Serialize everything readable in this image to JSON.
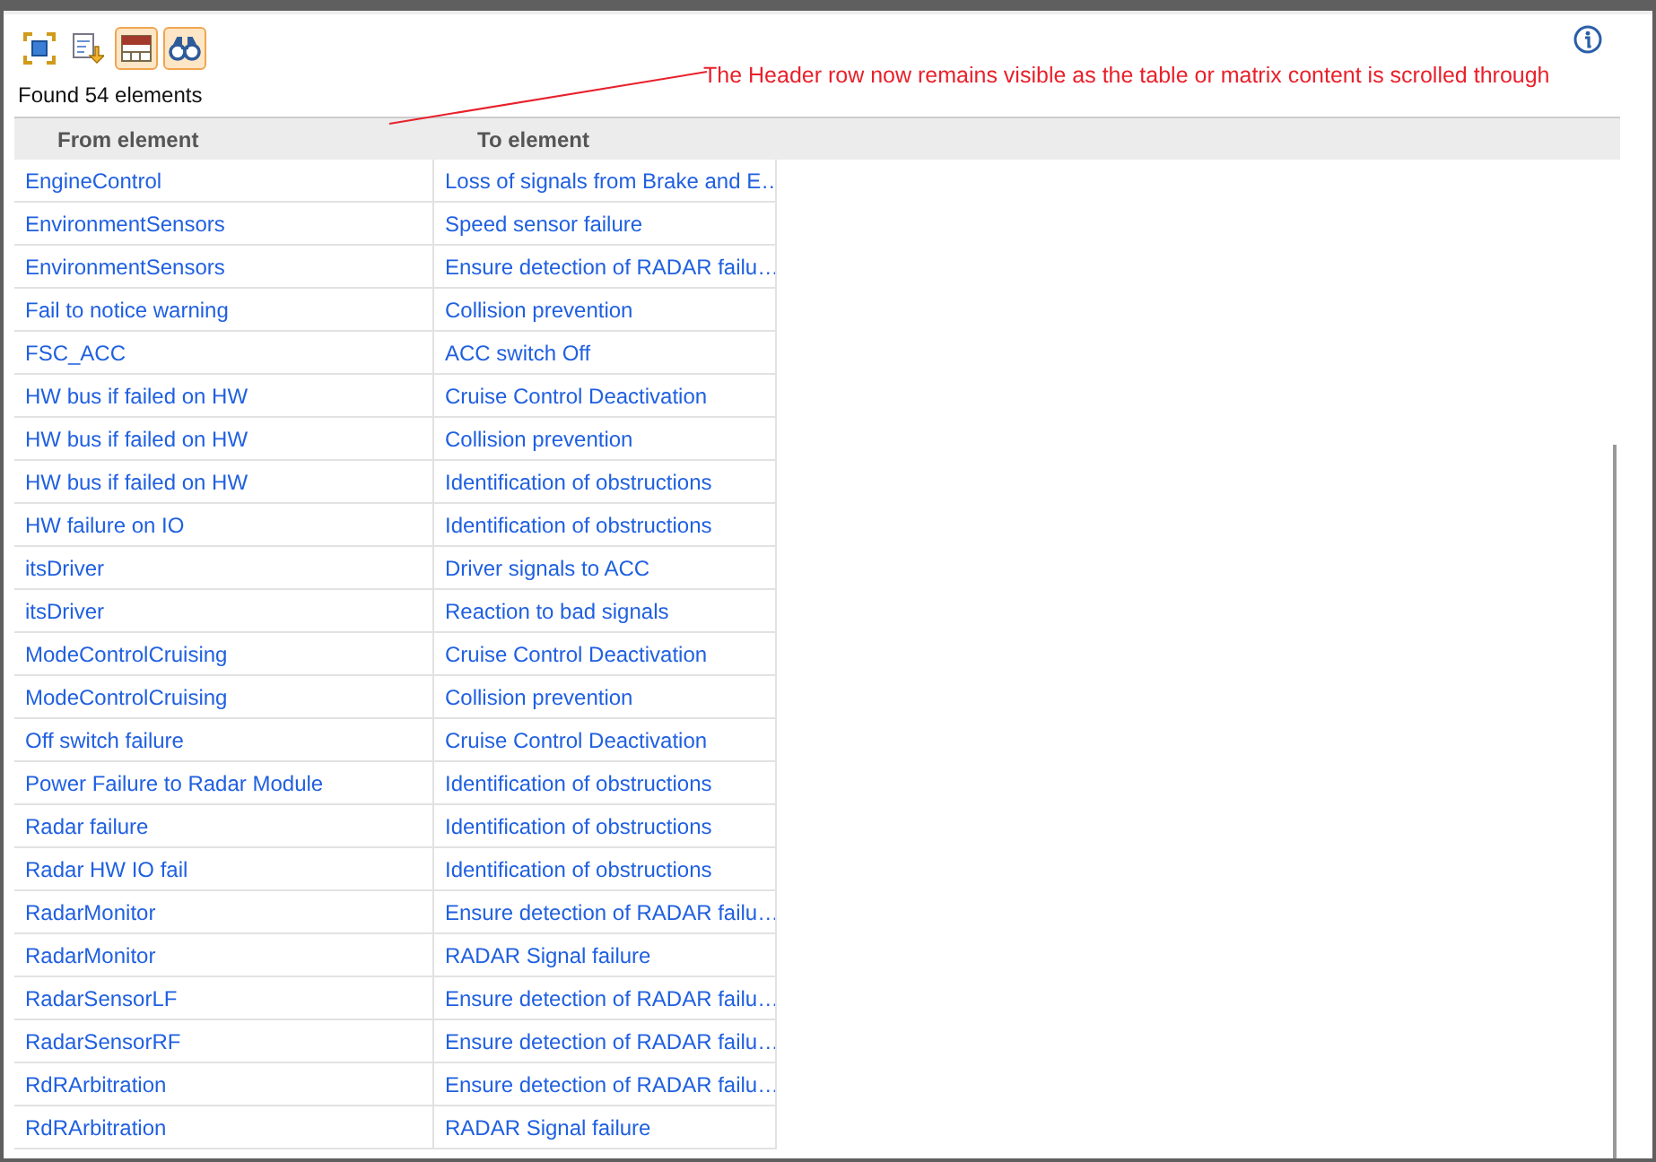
{
  "toolbar": [
    {
      "kind": "fit",
      "selected": false
    },
    {
      "kind": "export",
      "selected": false
    },
    {
      "kind": "header",
      "selected": true
    },
    {
      "kind": "find",
      "selected": true
    }
  ],
  "status": "Found 54 elements",
  "annotation": "The Header row now remains visible as the table or matrix content is scrolled through",
  "table": {
    "columns": [
      "From element",
      "To element"
    ],
    "rows": [
      [
        "EngineControl",
        "Loss of signals from Brake and E…"
      ],
      [
        "EnvironmentSensors",
        "Speed sensor failure"
      ],
      [
        "EnvironmentSensors",
        "Ensure detection of RADAR failu…"
      ],
      [
        "Fail to notice warning",
        "Collision prevention"
      ],
      [
        "FSC_ACC",
        "ACC switch Off"
      ],
      [
        "HW bus if failed on HW",
        "Cruise Control Deactivation"
      ],
      [
        "HW bus if failed on HW",
        "Collision prevention"
      ],
      [
        "HW bus if failed on HW",
        "Identification of obstructions"
      ],
      [
        "HW failure on IO",
        "Identification of obstructions"
      ],
      [
        "itsDriver",
        "Driver signals to ACC"
      ],
      [
        "itsDriver",
        "Reaction to bad signals"
      ],
      [
        "ModeControlCruising",
        "Cruise Control Deactivation"
      ],
      [
        "ModeControlCruising",
        "Collision prevention"
      ],
      [
        "Off switch failure",
        "Cruise Control Deactivation"
      ],
      [
        "Power Failure to Radar Module",
        "Identification of obstructions"
      ],
      [
        "Radar failure",
        "Identification of obstructions"
      ],
      [
        "Radar HW IO fail",
        "Identification of obstructions"
      ],
      [
        "RadarMonitor",
        "Ensure detection of RADAR failu…"
      ],
      [
        "RadarMonitor",
        "RADAR Signal failure"
      ],
      [
        "RadarSensorLF",
        "Ensure detection of RADAR failu…"
      ],
      [
        "RadarSensorRF",
        "Ensure detection of RADAR failu…"
      ],
      [
        "RdRArbitration",
        "Ensure detection of RADAR failu…"
      ],
      [
        "RdRArbitration",
        "RADAR Signal failure"
      ]
    ]
  }
}
